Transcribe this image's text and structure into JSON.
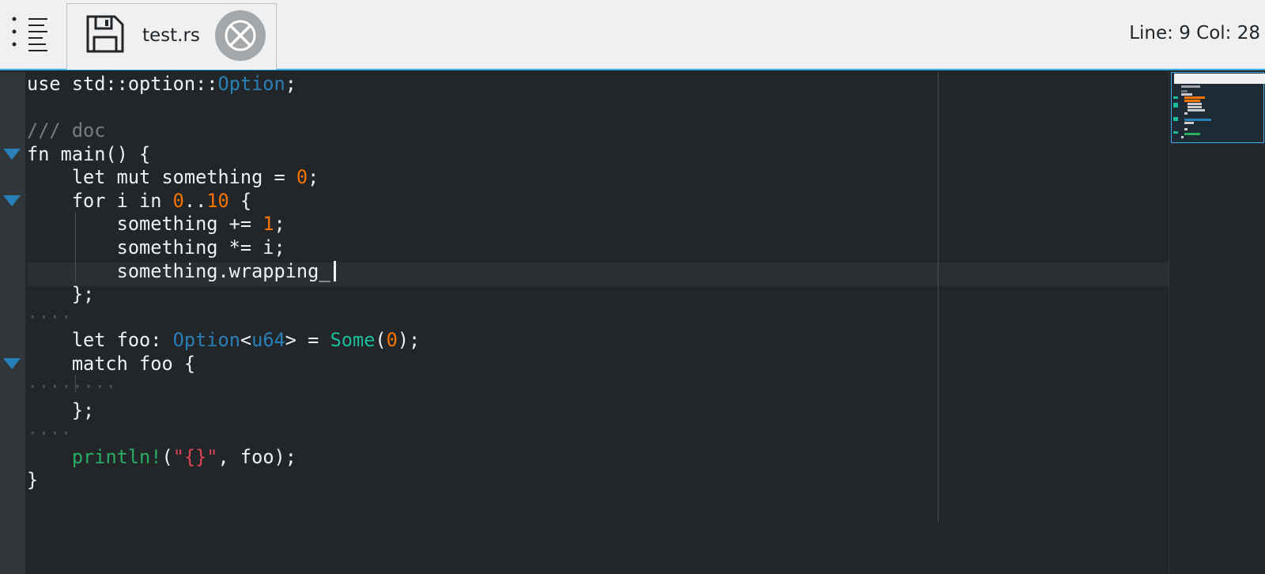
{
  "toolbar": {
    "menu_icon": "hamburger-menu-icon",
    "tab": {
      "filename": "test.rs",
      "save_icon": "floppy-disk-icon",
      "close_icon": "close-icon"
    },
    "status": "Line: 9 Col: 28"
  },
  "colors": {
    "accent": "#3daee9",
    "background": "#232629",
    "keyword_type": "#2980b9",
    "number": "#f67400",
    "function_macro": "#27ae60",
    "string": "#da4453",
    "variant": "#1abc9c",
    "comment": "#7a7c7d"
  },
  "code": {
    "l1": {
      "a": "use std::option::",
      "b": "Option",
      "c": ";"
    },
    "l3": {
      "a": "/// doc"
    },
    "l4": {
      "a": "fn main() {"
    },
    "l5": {
      "a": "    let mut something = ",
      "b": "0",
      "c": ";"
    },
    "l6": {
      "a": "    for i in ",
      "b": "0",
      "c": "..",
      "d": "10",
      "e": " {"
    },
    "l7": {
      "a": "        something += ",
      "b": "1",
      "c": ";"
    },
    "l8": {
      "a": "        something *= i;"
    },
    "l9": {
      "a": "        something.wrapping_"
    },
    "l10": {
      "a": "    };"
    },
    "l11": {
      "a": "····"
    },
    "l12": {
      "a": "    let foo: ",
      "b": "Option",
      "c": "<",
      "d": "u64",
      "e": "> = ",
      "f": "Some",
      "g": "(",
      "h": "0",
      "i": ");"
    },
    "l13": {
      "a": "    match foo {"
    },
    "l14": {
      "a": "········"
    },
    "l15": {
      "a": "    };"
    },
    "l16": {
      "a": "····"
    },
    "l17": {
      "a": "    ",
      "b": "println!",
      "c": "(",
      "d": "\"{}\"",
      "e": ", foo);"
    },
    "l18": {
      "a": "}"
    }
  }
}
